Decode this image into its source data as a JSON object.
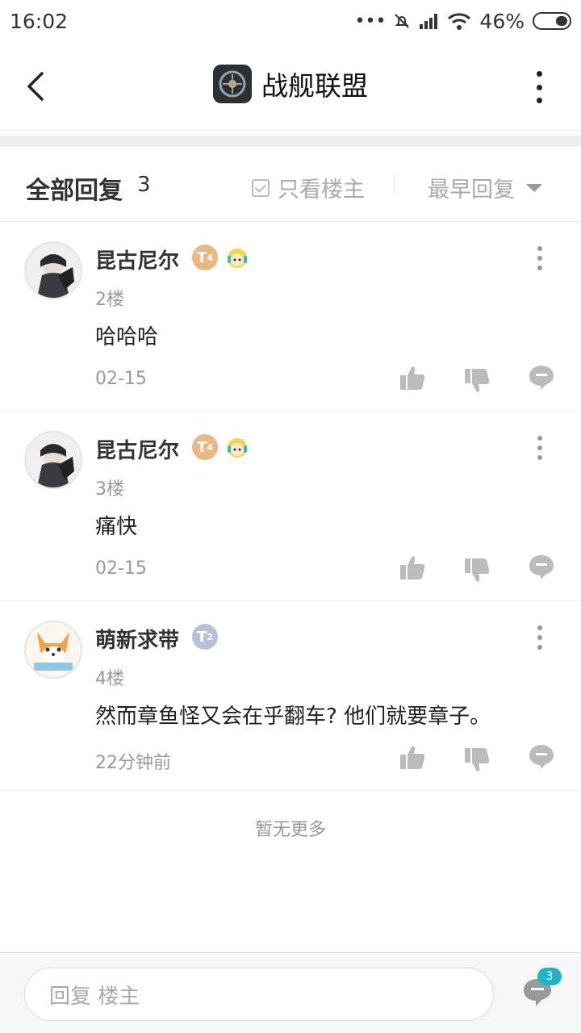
{
  "status_bar": {
    "time": "16:02",
    "dots": "•••",
    "battery": "46%"
  },
  "header": {
    "title": "战舰联盟",
    "back_icon": "chevron-left-icon",
    "more_icon": "more-vertical-icon"
  },
  "filter": {
    "all_replies_label": "全部回复",
    "count": "3",
    "only_owner_label": "只看楼主",
    "sort_label": "最早回复"
  },
  "posts": [
    {
      "username": "昆古尼尔",
      "badge": "T",
      "badge_level": "4",
      "floor": "2楼",
      "content": "哈哈哈",
      "time": "02-15"
    },
    {
      "username": "昆古尼尔",
      "badge": "T",
      "badge_level": "4",
      "floor": "3楼",
      "content": "痛快",
      "time": "02-15"
    },
    {
      "username": "萌新求带",
      "badge": "T",
      "badge_level": "2",
      "floor": "4楼",
      "content": "然而章鱼怪又会在乎翻车? 他们就要章子。",
      "time": "22分钟前"
    }
  ],
  "no_more": "暂无更多",
  "bottom": {
    "reply_placeholder": "回复  楼主",
    "comment_count": "3"
  },
  "colors": {
    "accent_badge": "#1fb4c9",
    "gold_badge": "#e8b887",
    "silver_badge": "#b9c1d9"
  }
}
